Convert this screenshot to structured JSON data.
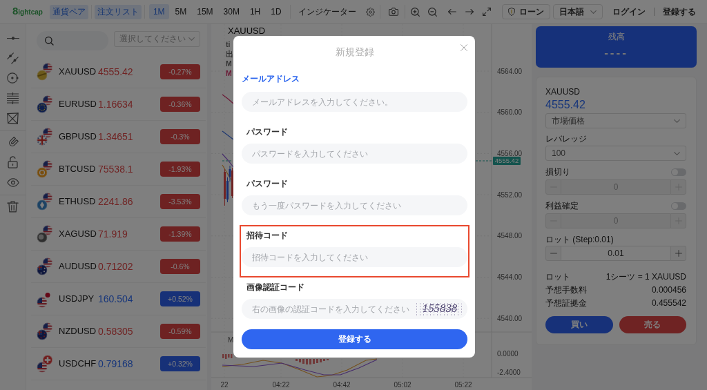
{
  "toolbar": {
    "logo": "8ightcap",
    "panel_tabs": [
      {
        "label": "通貨ペア",
        "selected": true
      },
      {
        "label": "注文リスト",
        "selected": true
      }
    ],
    "timeframes": [
      {
        "label": "1M",
        "selected": true
      },
      {
        "label": "5M",
        "selected": false
      },
      {
        "label": "15M",
        "selected": false
      },
      {
        "label": "30M",
        "selected": false
      },
      {
        "label": "1H",
        "selected": false
      },
      {
        "label": "1D",
        "selected": false
      }
    ],
    "indicators_button": "インジケーター",
    "loan_button": "ローン",
    "language": "日本語",
    "login_link": "ログイン",
    "register_link": "登録する"
  },
  "symbol_list": {
    "filter": {
      "placeholder": "選択してください"
    },
    "rows": [
      {
        "symbol": "XAUUSD",
        "price": "4555.42",
        "change": "-0.27%",
        "rising": false
      },
      {
        "symbol": "EURUSD",
        "price": "1.16634",
        "change": "-0.36%",
        "rising": false
      },
      {
        "symbol": "GBPUSD",
        "price": "1.34651",
        "change": "-0.3%",
        "rising": false
      },
      {
        "symbol": "BTCUSD",
        "price": "75538.1",
        "change": "-1.93%",
        "rising": false
      },
      {
        "symbol": "ETHUSD",
        "price": "2241.86",
        "change": "-3.53%",
        "rising": false
      },
      {
        "symbol": "XAGUSD",
        "price": "71.919",
        "change": "-1.39%",
        "rising": false
      },
      {
        "symbol": "AUDUSD",
        "price": "0.71202",
        "change": "-0.6%",
        "rising": false
      },
      {
        "symbol": "USDJPY",
        "price": "160.504",
        "change": "+0.52%",
        "rising": true
      },
      {
        "symbol": "NZDUSD",
        "price": "0.58305",
        "change": "-0.59%",
        "rising": false
      },
      {
        "symbol": "USDCHF",
        "price": "0.79168",
        "change": "+0.32%",
        "rising": true
      }
    ]
  },
  "chart": {
    "symbol": "XAUUSD",
    "legend": [
      {
        "text": "ti",
        "color": "#333333"
      },
      {
        "text": "出",
        "color": "#333333"
      },
      {
        "text": "M",
        "color": "#333333"
      },
      {
        "text": "M",
        "color": "#6b1a36"
      }
    ],
    "price_axis": [
      "4564.00",
      "4560.00",
      "4556.00",
      "4552.00",
      "4548.00",
      "4544.00",
      "4540.00"
    ],
    "price_tag": "4555.42",
    "indicator_label": "M",
    "indicator_axis": [
      "0.0000",
      "-2.4000"
    ],
    "time_axis": [
      "22",
      "04:22",
      "04:42",
      "05:02",
      "05:22"
    ]
  },
  "order_panel": {
    "balance_label": "残高",
    "balance_value": "----",
    "symbol": "XAUUSD",
    "price": "4555.42",
    "order_type": "市場価格",
    "leverage_label": "レバレッジ",
    "leverage": "100",
    "stop_loss": {
      "label": "損切り",
      "on": false,
      "value": "0"
    },
    "take_profit": {
      "label": "利益確定",
      "on": false,
      "value": "0"
    },
    "lot": {
      "label": "ロット (Step:0.01)",
      "value": "0.01"
    },
    "details": [
      {
        "label": "ロット",
        "value": "1シーツ = 1 XAUUSD"
      },
      {
        "label": "予想手数料",
        "value": "0.000456"
      },
      {
        "label": "予想証拠金",
        "value": "0.455542"
      }
    ],
    "buy_button": "買い",
    "sell_button": "売る"
  },
  "signup_dialog": {
    "title": "新規登録",
    "method_tabs": [
      {
        "label": "メールアドレス",
        "selected": true
      }
    ],
    "fields": [
      {
        "placeholder": "メールアドレスを入力してください。",
        "highlighted": false
      },
      {
        "label": "パスワード",
        "placeholder": "パスワードを入力してください",
        "highlighted": false
      },
      {
        "label": "パスワード",
        "placeholder": "もう一度パスワードを入力してください",
        "highlighted": false
      },
      {
        "label": "招待コード",
        "placeholder": "招待コードを入力してください",
        "highlighted": true
      },
      {
        "label": "画像認証コード",
        "placeholder": "右の画像の認証コードを入力してください",
        "highlighted": false,
        "captcha": "155838"
      }
    ],
    "submit_button": "登録する"
  }
}
